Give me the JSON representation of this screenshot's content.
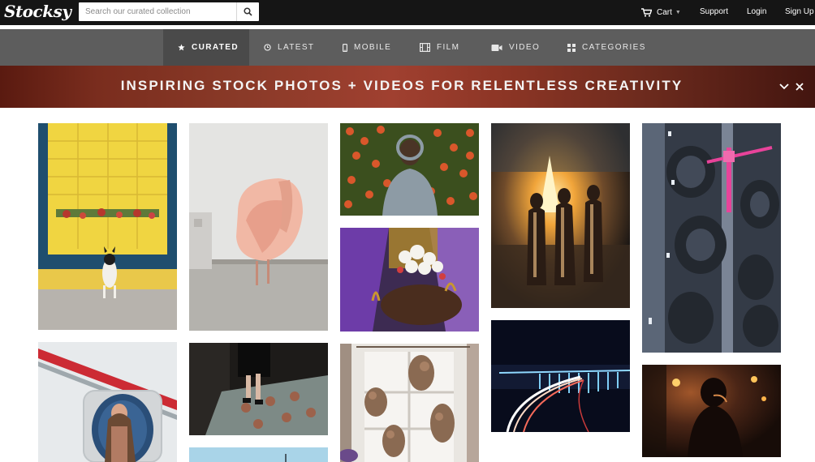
{
  "header": {
    "logo": "Stocksy",
    "search_placeholder": "Search our curated collection",
    "search_icon": "search-icon",
    "cart_label": "Cart",
    "support_label": "Support",
    "login_label": "Login",
    "signup_label": "Sign Up"
  },
  "nav": {
    "items": [
      {
        "label": "CURATED",
        "icon": "star-icon"
      },
      {
        "label": "LATEST",
        "icon": "clock-icon"
      },
      {
        "label": "MOBILE",
        "icon": "mobile-icon"
      },
      {
        "label": "FILM",
        "icon": "film-icon"
      },
      {
        "label": "VIDEO",
        "icon": "video-icon"
      },
      {
        "label": "CATEGORIES",
        "icon": "grid-icon"
      }
    ]
  },
  "banner": {
    "text": "INSPIRING STOCK PHOTOS + VIDEOS FOR RELENTLESS CREATIVITY",
    "chevron_icon": "chevron-down-icon",
    "close_icon": "close-icon"
  },
  "gallery": {
    "photos": [
      "photo-dog-yellow-window",
      "photo-pink-pelican",
      "photo-man-flower-wall",
      "photo-bonfire-women",
      "photo-aerial-crane",
      "photo-train-window-woman",
      "photo-legs-tiled-floor",
      "photo-flower-bouquet-hands",
      "photo-dried-flowers-window",
      "photo-night-light-trails",
      "photo-woman-candlelight",
      "photo-sky-bottom"
    ]
  },
  "colors": {
    "topbar": "#151515",
    "nav_bg": "#5d5d5d",
    "nav_active_bg": "#4a4a4a",
    "banner_accent": "#8a3a28"
  }
}
